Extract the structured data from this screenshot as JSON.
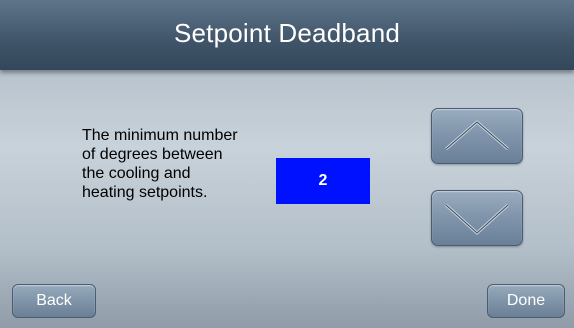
{
  "header": {
    "title": "Setpoint Deadband"
  },
  "description": {
    "line1": "The minimum number",
    "line2": "of degrees between",
    "line3": "the cooling and",
    "line4": "heating setpoints."
  },
  "deadband": {
    "value": "2"
  },
  "buttons": {
    "back_label": "Back",
    "done_label": "Done"
  },
  "colors": {
    "value_box": "#0011ff",
    "header": "#3f5468"
  }
}
